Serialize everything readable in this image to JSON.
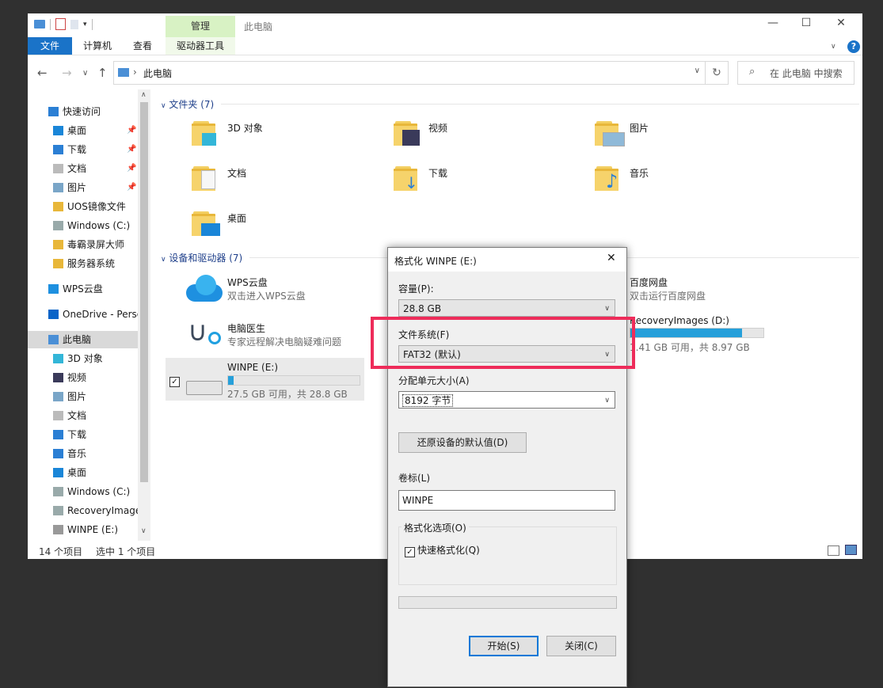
{
  "window": {
    "title": "此电脑",
    "contextual_tab": "管理",
    "ribbon_tabs": [
      "文件",
      "计算机",
      "查看",
      "驱动器工具"
    ],
    "address_path": "此电脑",
    "search_placeholder": "在 此电脑 中搜索"
  },
  "nav": {
    "items": [
      {
        "label": "快速访问",
        "icon": "star-icon",
        "pinned": false
      },
      {
        "label": "桌面",
        "icon": "desktop-icon",
        "pinned": true
      },
      {
        "label": "下载",
        "icon": "download-icon",
        "pinned": true
      },
      {
        "label": "文档",
        "icon": "document-icon",
        "pinned": true
      },
      {
        "label": "图片",
        "icon": "picture-icon",
        "pinned": true
      },
      {
        "label": "UOS镜像文件",
        "icon": "folder-icon",
        "pinned": false
      },
      {
        "label": "Windows (C:)",
        "icon": "drive-icon",
        "pinned": false
      },
      {
        "label": "毒霸录屏大师",
        "icon": "folder-icon",
        "pinned": false
      },
      {
        "label": "服务器系统",
        "icon": "folder-icon",
        "pinned": false
      },
      {
        "label": "WPS云盘",
        "icon": "cloud-icon",
        "pinned": false
      },
      {
        "label": "OneDrive - Perso",
        "icon": "onedrive-icon",
        "pinned": false
      },
      {
        "label": "此电脑",
        "icon": "computer-icon",
        "pinned": false
      },
      {
        "label": "3D 对象",
        "icon": "cube-icon",
        "pinned": false
      },
      {
        "label": "视频",
        "icon": "video-icon",
        "pinned": false
      },
      {
        "label": "图片",
        "icon": "picture-icon",
        "pinned": false
      },
      {
        "label": "文档",
        "icon": "document-icon",
        "pinned": false
      },
      {
        "label": "下载",
        "icon": "download-icon",
        "pinned": false
      },
      {
        "label": "音乐",
        "icon": "music-icon",
        "pinned": false
      },
      {
        "label": "桌面",
        "icon": "desktop-icon",
        "pinned": false
      },
      {
        "label": "Windows (C:)",
        "icon": "drive-icon",
        "pinned": false
      },
      {
        "label": "RecoveryImage",
        "icon": "drive-icon",
        "pinned": false
      },
      {
        "label": "WINPE (E:)",
        "icon": "usb-drive-icon",
        "pinned": false
      }
    ]
  },
  "content": {
    "folders_header": "文件夹 (7)",
    "folders": [
      "3D 对象",
      "视频",
      "图片",
      "文档",
      "下载",
      "音乐",
      "桌面"
    ],
    "devices_header": "设备和驱动器 (7)",
    "devices": [
      {
        "name": "WPS云盘",
        "sub": "双击进入WPS云盘"
      },
      {
        "name": "百度网盘",
        "sub": "双击运行百度网盘"
      },
      {
        "name": "电脑医生",
        "sub": "专家远程解决电脑疑难问题"
      },
      {
        "name": "RecoveryImages (D:)",
        "sub": "1.41 GB 可用，共 8.97 GB",
        "used_fraction": 0.84
      },
      {
        "name": "WINPE (E:)",
        "sub": "27.5 GB 可用，共 28.8 GB",
        "used_fraction": 0.04
      }
    ]
  },
  "status": {
    "count": "14 个项目",
    "selected": "选中 1 个项目"
  },
  "dialog": {
    "title": "格式化 WINPE (E:)",
    "capacity_label": "容量(P):",
    "capacity_value": "28.8 GB",
    "fs_label": "文件系统(F)",
    "fs_value": "FAT32 (默认)",
    "alloc_label": "分配单元大小(A)",
    "alloc_value": "8192 字节",
    "restore_label": "还原设备的默认值(D)",
    "volume_label": "卷标(L)",
    "volume_value": "WINPE",
    "options_label": "格式化选项(O)",
    "quick_format_label": "快速格式化(Q)",
    "quick_format_checked": true,
    "start_label": "开始(S)",
    "close_label": "关闭(C)"
  },
  "colors": {
    "accent": "#1a73c8",
    "highlight": "#ee2c5a",
    "context_tab": "#d8f2c4"
  }
}
